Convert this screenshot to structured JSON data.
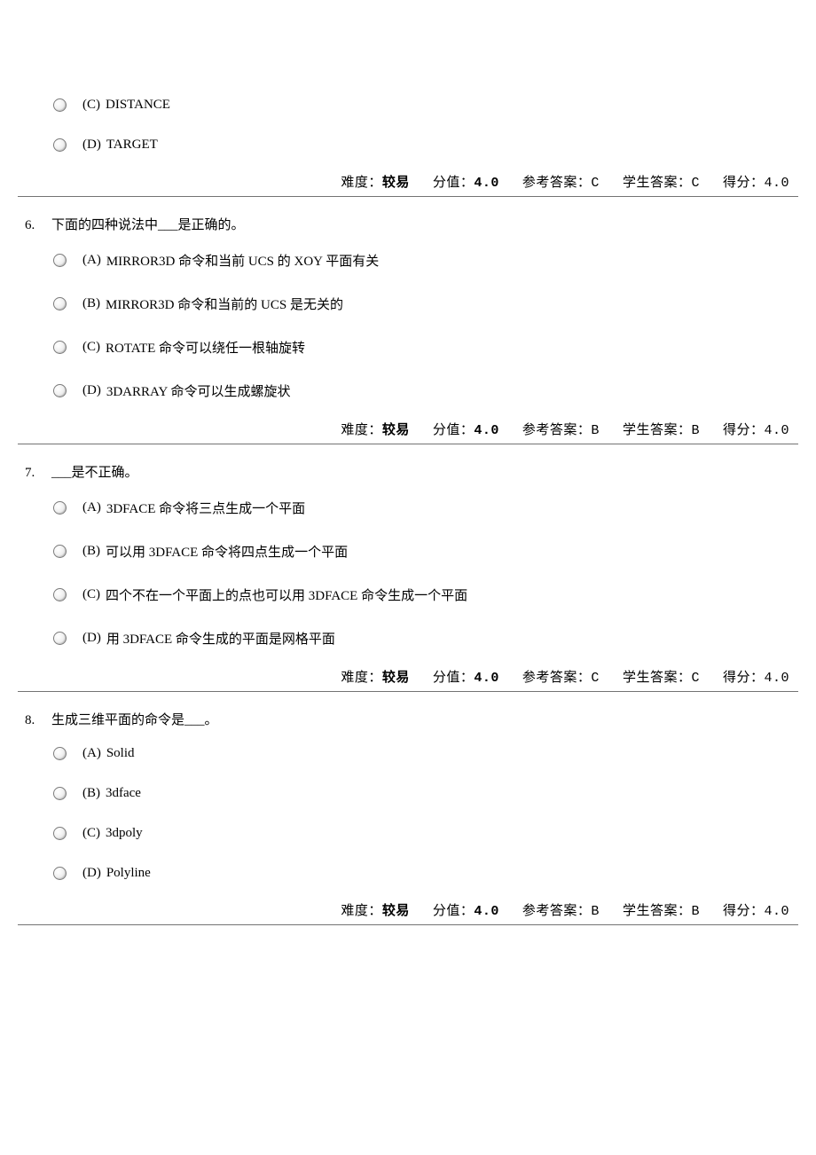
{
  "meta_labels": {
    "difficulty": "难度：",
    "points": "分值：",
    "ref_answer": "参考答案：",
    "student_answer": "学生答案：",
    "score": "得分："
  },
  "orphan": {
    "options": [
      {
        "label": "(C)",
        "text": "DISTANCE"
      },
      {
        "label": "(D)",
        "text": "TARGET"
      }
    ],
    "meta": {
      "difficulty": "较易",
      "points": "4.0",
      "ref_answer": "C",
      "student_answer": "C",
      "score": "4.0"
    }
  },
  "questions": [
    {
      "number": "6.",
      "text": "下面的四种说法中___是正确的。",
      "options": [
        {
          "label": "(A)",
          "text": "MIRROR3D 命令和当前 UCS 的 XOY 平面有关"
        },
        {
          "label": "(B)",
          "text": "MIRROR3D 命令和当前的 UCS 是无关的"
        },
        {
          "label": "(C)",
          "text": "ROTATE 命令可以绕任一根轴旋转"
        },
        {
          "label": "(D)",
          "text": "3DARRAY 命令可以生成螺旋状"
        }
      ],
      "meta": {
        "difficulty": "较易",
        "points": "4.0",
        "ref_answer": "B",
        "student_answer": "B",
        "score": "4.0"
      }
    },
    {
      "number": "7.",
      "text": "___是不正确。",
      "options": [
        {
          "label": "(A)",
          "text": "3DFACE 命令将三点生成一个平面"
        },
        {
          "label": "(B)",
          "text": "可以用 3DFACE 命令将四点生成一个平面"
        },
        {
          "label": "(C)",
          "text": "四个不在一个平面上的点也可以用 3DFACE 命令生成一个平面"
        },
        {
          "label": "(D)",
          "text": "用 3DFACE 命令生成的平面是网格平面"
        }
      ],
      "meta": {
        "difficulty": "较易",
        "points": "4.0",
        "ref_answer": "C",
        "student_answer": "C",
        "score": "4.0"
      }
    },
    {
      "number": "8.",
      "text": "生成三维平面的命令是___。",
      "options": [
        {
          "label": "(A)",
          "text": "Solid"
        },
        {
          "label": "(B)",
          "text": "3dface"
        },
        {
          "label": "(C)",
          "text": "3dpoly"
        },
        {
          "label": "(D)",
          "text": "Polyline"
        }
      ],
      "meta": {
        "difficulty": "较易",
        "points": "4.0",
        "ref_answer": "B",
        "student_answer": "B",
        "score": "4.0"
      }
    }
  ]
}
